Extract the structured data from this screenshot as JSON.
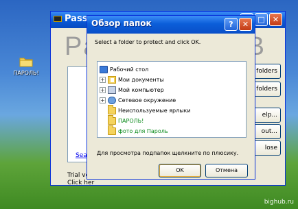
{
  "desktop": {
    "icon_label": "ПАРОЛЬ!",
    "watermark": "bighub.ru"
  },
  "background_window": {
    "title": "Passw",
    "big_text_left": "Pa",
    "big_text_right": "B",
    "buttons": [
      "folders",
      "k folders",
      "elp...",
      "out...",
      "lose"
    ],
    "search_label": "Search",
    "trial_line1": "Trial ver",
    "trial_line2": "Click her"
  },
  "dialog": {
    "title": "Обзор папок",
    "help_btn": "?",
    "close_btn": "✕",
    "instruction": "Select a folder to protect and click OK.",
    "tree": [
      {
        "label": "Рабочий стол",
        "icon": "desktop-icon",
        "expander": "",
        "color": "plain"
      },
      {
        "label": "Мои документы",
        "icon": "my-documents-icon",
        "expander": "+",
        "color": "plain"
      },
      {
        "label": "Мой компьютер",
        "icon": "computer-icon",
        "expander": "+",
        "color": "plain"
      },
      {
        "label": "Сетевое окружение",
        "icon": "network-icon",
        "expander": "+",
        "color": "plain"
      },
      {
        "label": "Неиспользуемые ярлыки",
        "icon": "folder-icon",
        "expander": "",
        "color": "plain"
      },
      {
        "label": "ПАРОЛЬ!",
        "icon": "folder-icon",
        "expander": "",
        "color": "green"
      },
      {
        "label": "фото для Пароль",
        "icon": "folder-icon",
        "expander": "",
        "color": "green"
      }
    ],
    "hint": "Для просмотра подпапок щелкните по плюсику.",
    "ok_label": "OK",
    "cancel_label": "Отмена"
  },
  "colors": {
    "xp_title_blue": "#0a5bd8",
    "dialog_face": "#ece9d8",
    "green_label": "#0a8a1a"
  }
}
